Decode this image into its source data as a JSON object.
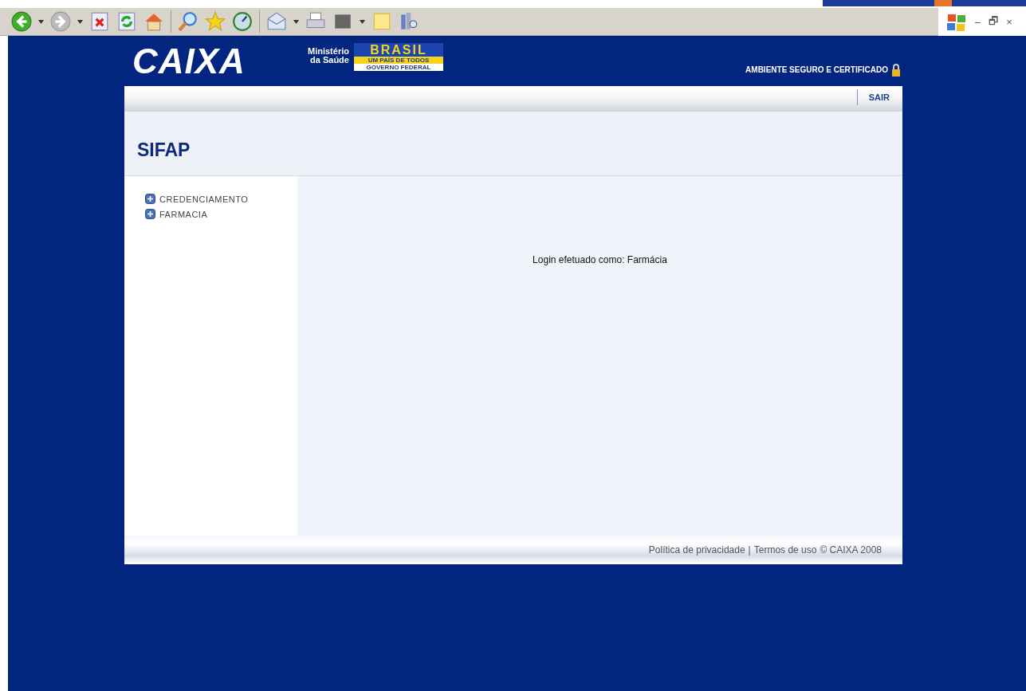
{
  "browser_toolbar": {
    "glyphs": [
      "–",
      "🗗",
      "×"
    ]
  },
  "header": {
    "logo": "CAIXA",
    "ministry": [
      "Ministério",
      "da Saúde"
    ],
    "brasil": {
      "word": "BRASIL",
      "slogan": "UM PAÍS DE TODOS",
      "government": "GOVERNO FEDERAL"
    },
    "security": "AMBIENTE SEGURO E CERTIFICADO"
  },
  "nav": {
    "logout": "SAIR"
  },
  "title": "SIFAP",
  "sidebar": {
    "items": [
      {
        "label": "CREDENCIAMENTO",
        "expanded": false
      },
      {
        "label": "FARMACIA",
        "expanded": false
      }
    ]
  },
  "content": {
    "message": "Login efetuado como: Farmácia"
  },
  "footer": {
    "privacy": "Política de privacidade",
    "separator": "|",
    "terms": "Termos de uso",
    "copyright": "© CAIXA 2008"
  }
}
